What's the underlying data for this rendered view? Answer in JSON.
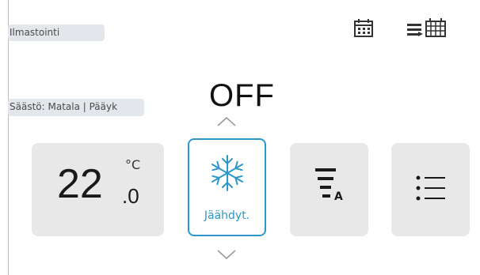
{
  "header": {
    "title": "Ilmastointi"
  },
  "status": {
    "mode_summary": "Säästö: Matala | Pääyk"
  },
  "power": {
    "state": "OFF"
  },
  "temperature": {
    "integer": "22",
    "decimal": ".0",
    "unit": "°C"
  },
  "mode": {
    "label": "Jäähdyt.",
    "accent_color": "#2d97c9"
  },
  "fan": {
    "badge": "A"
  },
  "icons": {
    "calendar": "calendar-icon",
    "schedule": "weekly-schedule-icon",
    "snow": "snowflake-icon",
    "fan": "fan-speed-icon",
    "menu": "list-menu-icon",
    "chev_up": "chevron-up-icon",
    "chev_down": "chevron-down-icon"
  }
}
